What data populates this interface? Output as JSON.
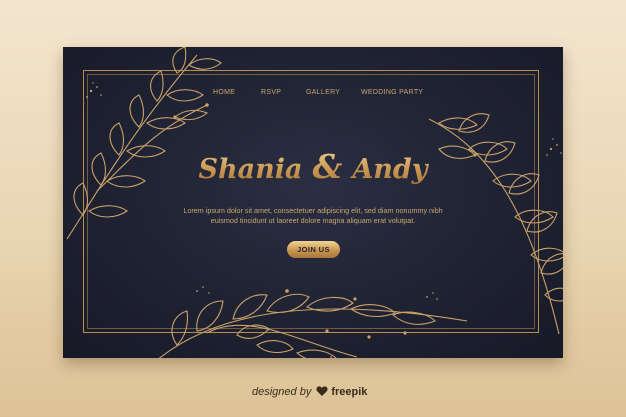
{
  "nav": {
    "items": [
      {
        "label": "HOME"
      },
      {
        "label": "RSVP"
      },
      {
        "label": "GALLERY"
      },
      {
        "label": "WEDDING PARTY"
      }
    ]
  },
  "hero": {
    "name_left": "Shania",
    "ampersand": "&",
    "name_right": "Andy",
    "body_line1": "Lorem ipsum dolor sit amet, consectetuer adipiscing elit, sed diam nonummy nibh",
    "body_line2": "euismod tincidunt ut laoreet dolore magna aliquam erat volutpat.",
    "cta_label": "JOIN US"
  },
  "credit": {
    "designed_by": "designed by",
    "brand": "freepik",
    "icon": "freepik-logo-icon"
  },
  "colors": {
    "background": "#e9d6b3",
    "page": "#1f2232",
    "gold": "#c9a770"
  }
}
